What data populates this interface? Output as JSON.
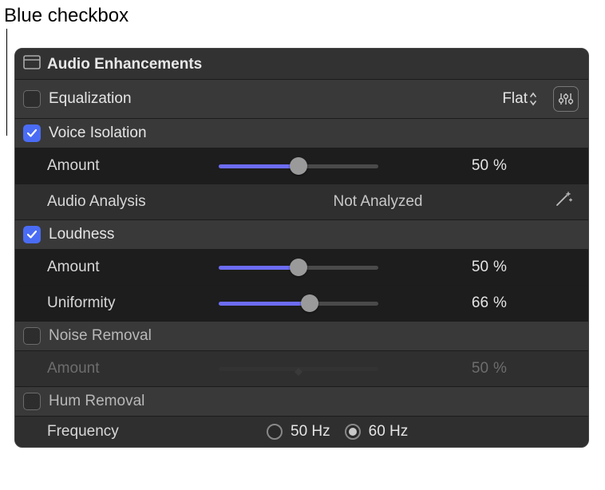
{
  "callout": {
    "text": "Blue checkbox"
  },
  "panel": {
    "title": "Audio Enhancements"
  },
  "equalization": {
    "label": "Equalization",
    "checked": false,
    "preset": "Flat"
  },
  "voiceIsolation": {
    "label": "Voice Isolation",
    "checked": true,
    "amount": {
      "label": "Amount",
      "value": "50",
      "unit": "%",
      "pct": 50
    },
    "analysis": {
      "label": "Audio Analysis",
      "value": "Not Analyzed"
    }
  },
  "loudness": {
    "label": "Loudness",
    "checked": true,
    "amount": {
      "label": "Amount",
      "value": "50",
      "unit": "%",
      "pct": 50
    },
    "uniformity": {
      "label": "Uniformity",
      "value": "66",
      "unit": "%",
      "pct": 66
    }
  },
  "noiseRemoval": {
    "label": "Noise Removal",
    "checked": false,
    "amount": {
      "label": "Amount",
      "value": "50",
      "unit": "%",
      "pct": 50
    }
  },
  "humRemoval": {
    "label": "Hum Removal",
    "checked": false,
    "frequency": {
      "label": "Frequency",
      "options": [
        {
          "label": "50 Hz",
          "selected": false
        },
        {
          "label": "60 Hz",
          "selected": true
        }
      ]
    }
  },
  "colors": {
    "accent": "#6c6cf5",
    "checkboxBlue": "#4a6cf5"
  }
}
